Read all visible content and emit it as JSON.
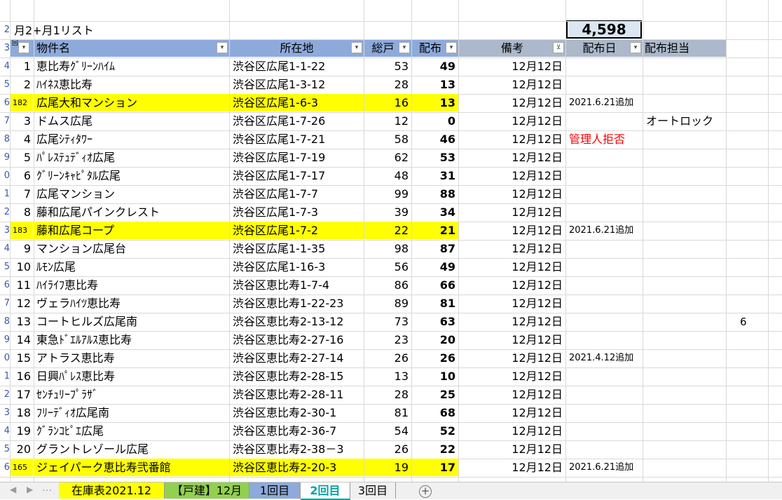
{
  "sheet": {
    "title": "月2+月1リスト",
    "total": "4,598",
    "side_value": "6",
    "row_numbers": [
      "2",
      "3",
      "4",
      "5",
      "6",
      "7",
      "8",
      "9",
      "0",
      "1",
      "2",
      "3",
      "4",
      "5",
      "6",
      "7",
      "8",
      "9",
      "0",
      "1",
      "2",
      "3",
      "4",
      "5",
      "6"
    ],
    "headers": [
      "物件名",
      "所在地",
      "総戸",
      "配布",
      "備考",
      "配布日",
      "配布担当"
    ],
    "filter_icon": "filter-sort-icon",
    "rows": [
      {
        "no": "1",
        "name": "恵比寿ｸﾞﾘｰﾝﾊｲﾑ",
        "addr": "渋谷区広尾1-1-22",
        "total": "53",
        "dist": "49",
        "date": "12月12日",
        "note": "",
        "owner": "",
        "hl": false
      },
      {
        "no": "2",
        "name": "ﾊｲﾈｽ恵比寿",
        "addr": "渋谷区広尾1-3-12",
        "total": "28",
        "dist": "13",
        "date": "12月12日",
        "note": "",
        "owner": "",
        "hl": false
      },
      {
        "no": "182",
        "name": "広尾大和マンション",
        "addr": "渋谷区広尾1-6-3",
        "total": "16",
        "dist": "13",
        "date": "12月12日",
        "note": "2021.6.21追加",
        "owner": "",
        "hl": true
      },
      {
        "no": "3",
        "name": "ドムス広尾",
        "addr": "渋谷区広尾1-7-26",
        "total": "12",
        "dist": "0",
        "date": "12月12日",
        "note": "",
        "owner": "オートロック",
        "hl": false
      },
      {
        "no": "4",
        "name": "広尾ｼﾃｨﾀﾜｰ",
        "addr": "渋谷区広尾1-7-21",
        "total": "58",
        "dist": "46",
        "date": "12月12日",
        "note": "管理人拒否",
        "owner": "",
        "hl": false,
        "red": true
      },
      {
        "no": "5",
        "name": "ﾊﾟﾚｽﾃｭﾃﾞｨｵ広尾",
        "addr": "渋谷区広尾1-7-19",
        "total": "62",
        "dist": "53",
        "date": "12月12日",
        "note": "",
        "owner": "",
        "hl": false
      },
      {
        "no": "6",
        "name": "ｸﾞﾘｰﾝｷｬﾋﾟﾀﾙ広尾",
        "addr": "渋谷区広尾1-7-17",
        "total": "48",
        "dist": "31",
        "date": "12月12日",
        "note": "",
        "owner": "",
        "hl": false
      },
      {
        "no": "7",
        "name": "広尾マンション",
        "addr": "渋谷区広尾1-7-7",
        "total": "99",
        "dist": "88",
        "date": "12月12日",
        "note": "",
        "owner": "",
        "hl": false
      },
      {
        "no": "8",
        "name": "藤和広尾パインクレスト",
        "addr": "渋谷区広尾1-7-3",
        "total": "39",
        "dist": "34",
        "date": "12月12日",
        "note": "",
        "owner": "",
        "hl": false
      },
      {
        "no": "183",
        "name": "藤和広尾コープ",
        "addr": "渋谷区広尾1-7-2",
        "total": "22",
        "dist": "21",
        "date": "12月12日",
        "note": "2021.6.21追加",
        "owner": "",
        "hl": true
      },
      {
        "no": "9",
        "name": "マンション広尾台",
        "addr": "渋谷区広尾1-1-35",
        "total": "98",
        "dist": "87",
        "date": "12月12日",
        "note": "",
        "owner": "",
        "hl": false
      },
      {
        "no": "10",
        "name": "ﾙﾓﾝ広尾",
        "addr": "渋谷区広尾1-16-3",
        "total": "56",
        "dist": "49",
        "date": "12月12日",
        "note": "",
        "owner": "",
        "hl": false
      },
      {
        "no": "11",
        "name": "ﾊｲﾗｲﾌ恵比寿",
        "addr": "渋谷区恵比寿1-7-4",
        "total": "86",
        "dist": "66",
        "date": "12月12日",
        "note": "",
        "owner": "",
        "hl": false
      },
      {
        "no": "12",
        "name": "ヴェラﾊｲﾂ恵比寿",
        "addr": "渋谷区恵比寿1-22-23",
        "total": "89",
        "dist": "81",
        "date": "12月12日",
        "note": "",
        "owner": "",
        "hl": false
      },
      {
        "no": "13",
        "name": "コートヒルズ広尾南",
        "addr": "渋谷区恵比寿2-13-12",
        "total": "73",
        "dist": "63",
        "date": "12月12日",
        "note": "",
        "owner": "",
        "hl": false
      },
      {
        "no": "14",
        "name": "東急ﾄﾞｴﾙｱﾙｽ恵比寿",
        "addr": "渋谷区恵比寿2-27-16",
        "total": "23",
        "dist": "20",
        "date": "12月12日",
        "note": "",
        "owner": "",
        "hl": false
      },
      {
        "no": "15",
        "name": "アトラス恵比寿",
        "addr": "渋谷区恵比寿2-27-14",
        "total": "26",
        "dist": "26",
        "date": "12月12日",
        "note": "2021.4.12追加",
        "owner": "",
        "hl": false
      },
      {
        "no": "16",
        "name": "日興ﾊﾟﾚｽ恵比寿",
        "addr": "渋谷区恵比寿2-28-15",
        "total": "13",
        "dist": "10",
        "date": "12月12日",
        "note": "",
        "owner": "",
        "hl": false
      },
      {
        "no": "17",
        "name": "ｾﾝﾁｭﾘｰﾌﾟﾗｻﾞ",
        "addr": "渋谷区恵比寿2-28-11",
        "total": "28",
        "dist": "25",
        "date": "12月12日",
        "note": "",
        "owner": "",
        "hl": false
      },
      {
        "no": "18",
        "name": "ﾌﾘｰﾃﾞｨｵ広尾南",
        "addr": "渋谷区恵比寿2-30-1",
        "total": "81",
        "dist": "68",
        "date": "12月12日",
        "note": "",
        "owner": "",
        "hl": false
      },
      {
        "no": "19",
        "name": "ｸﾞﾗﾝｺﾋﾟｴ広尾",
        "addr": "渋谷区恵比寿2-36-7",
        "total": "54",
        "dist": "52",
        "date": "12月12日",
        "note": "",
        "owner": "",
        "hl": false
      },
      {
        "no": "20",
        "name": "グラントレゾール広尾",
        "addr": "渋谷区恵比寿2-38－3",
        "total": "26",
        "dist": "22",
        "date": "12月12日",
        "note": "",
        "owner": "",
        "hl": false
      },
      {
        "no": "165",
        "name": "ジェイパーク恵比寿弐番館",
        "addr": "渋谷区恵比寿2-20-3",
        "total": "19",
        "dist": "17",
        "date": "12月12日",
        "note": "2021.6.21追加",
        "owner": "",
        "hl": true
      }
    ]
  },
  "tabs": [
    {
      "label": "在庫表2021.12",
      "bg": "#ffff00",
      "color": "#000000"
    },
    {
      "label": "【戸建】12月",
      "bg": "#92d050",
      "color": "#000000"
    },
    {
      "label": "1回目",
      "bg": "#8eaadb",
      "color": "#000000"
    },
    {
      "label": "2回目",
      "bg": "#ffffff",
      "color": "#00a1a1"
    },
    {
      "label": "3回目",
      "bg": "#ffffff",
      "color": "#000000"
    }
  ],
  "add_sheet_icon": "add-sheet-icon"
}
